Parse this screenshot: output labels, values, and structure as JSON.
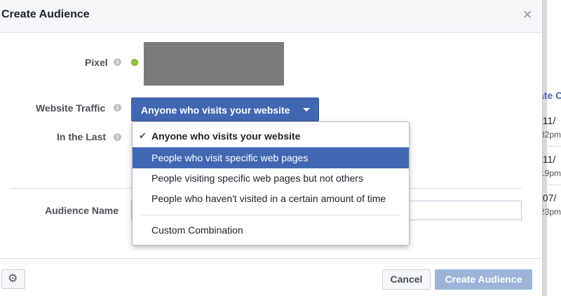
{
  "dialog": {
    "title": "Create Audience",
    "close_symbol": "×"
  },
  "form": {
    "pixel_label": "Pixel",
    "pixel_status": "active",
    "website_traffic_label": "Website Traffic",
    "website_traffic_value": "Anyone who visits your website",
    "in_the_last_label": "In the Last",
    "audience_name_label": "Audience Name",
    "audience_name_value": "",
    "info_symbol": "i"
  },
  "dropdown": {
    "items": [
      {
        "label": "Anyone who visits your website",
        "selected": true,
        "highlighted": false
      },
      {
        "label": "People who visit specific web pages",
        "selected": false,
        "highlighted": true
      },
      {
        "label": "People visiting specific web pages but not others",
        "selected": false,
        "highlighted": false
      },
      {
        "label": "People who haven't visited in a certain amount of time",
        "selected": false,
        "highlighted": false
      }
    ],
    "extra_item": {
      "label": "Custom Combination"
    },
    "check_symbol": "✔"
  },
  "footer": {
    "settings_icon": "gear-icon",
    "cancel_label": "Cancel",
    "create_label": "Create Audience",
    "create_enabled": false
  },
  "background": {
    "link_fragment": "ate C",
    "rows": [
      {
        "date": "/11/",
        "time": "32pm"
      },
      {
        "date": "/11/",
        "time": "19pm"
      },
      {
        "date": "/07/",
        "time": "23pm"
      }
    ]
  },
  "colors": {
    "primary": "#4267b2",
    "status_green": "#8fc541",
    "disabled_primary": "#9cb4d8"
  }
}
